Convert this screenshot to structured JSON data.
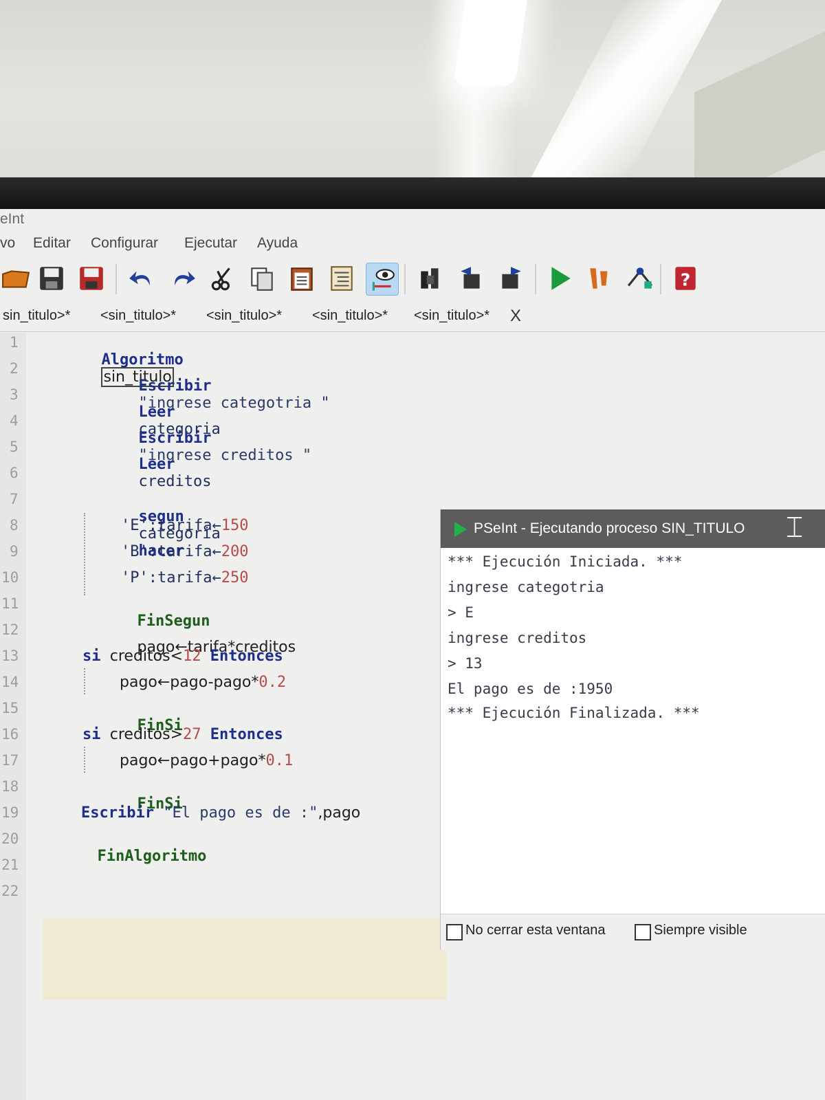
{
  "window": {
    "title": "eInt"
  },
  "menu": {
    "items": [
      "vo",
      "Editar",
      "Configurar",
      "Ejecutar",
      "Ayuda"
    ]
  },
  "toolbar": {
    "icons": [
      "open-folder-icon",
      "save-icon",
      "save-as-icon",
      "undo-icon",
      "redo-icon",
      "cut-icon",
      "copy-icon",
      "paste-icon",
      "indent-icon",
      "debug-watch-icon",
      "search-icon",
      "search-prev-icon",
      "search-next-icon",
      "run-icon",
      "step-icon",
      "flowchart-icon",
      "help-icon"
    ]
  },
  "tabs": {
    "items": [
      "sin_titulo>*",
      "<sin_titulo>*",
      "<sin_titulo>*",
      "<sin_titulo>*",
      "<sin_titulo>*"
    ],
    "close": "X"
  },
  "editor": {
    "line_numbers": [
      "1",
      "2",
      "3",
      "4",
      "5",
      "6",
      "7",
      "8",
      "9",
      "10",
      "11",
      "12",
      "13",
      "14",
      "15",
      "16",
      "17",
      "18",
      "19",
      "20",
      "21",
      "22"
    ],
    "lines": {
      "l1_kw": "Algoritmo",
      "l1_name": "sin_titulo",
      "l2_kw": "Escribir",
      "l2_str": "\"ingrese categotria \"",
      "l3_kw": "Leer",
      "l3_id": "categoria",
      "l4_kw": "Escribir",
      "l4_str": "\"ingrese creditos \"",
      "l5_kw": "Leer",
      "l5_id": "creditos",
      "l7_kw": "segun",
      "l7_id": "categoria",
      "l7_kw2": "hacer",
      "l8_a": "'E'",
      "l8_b": ":tarifa←",
      "l8_n": "150",
      "l9_a": "'B'",
      "l9_b": ":tarifa←",
      "l9_n": "200",
      "l10_a": "'P'",
      "l10_b": ":tarifa←",
      "l10_n": "250",
      "l11_kw": "FinSegun",
      "l12_id": "pago←tarifa*creditos",
      "l13_kw": "si",
      "l13_id": "creditos<",
      "l13_n": "12",
      "l13_kw2": "Entonces",
      "l14_id": "pago←pago-pago*",
      "l14_n": "0.2",
      "l15_kw": "FinSi",
      "l16_kw": "si",
      "l16_id": "creditos>",
      "l16_n": "27",
      "l16_kw2": "Entonces",
      "l17_id": "pago←pago+pago*",
      "l17_n": "0.1",
      "l18_kw": "FinSi",
      "l19_kw": "Escribir",
      "l19_str": "\"El pago es de :\"",
      "l19_id": ",pago",
      "l20_kw": "FinAlgoritmo"
    }
  },
  "run_window": {
    "title": "PSeInt - Ejecutando proceso SIN_TITULO",
    "output": [
      "*** Ejecución Iniciada. ***",
      "ingrese categotria",
      "> E",
      "ingrese creditos",
      "> 13",
      "El pago es de :1950",
      "*** Ejecución Finalizada. ***"
    ],
    "no_cerrar_label": "No cerrar esta ventana",
    "siempre_visible_label": "Siempre visible"
  },
  "colors": {
    "keyword": "#1d2e8c",
    "number": "#b84a4a",
    "highlight": "#f0ead2",
    "run_title_bg": "#5c5c5c",
    "run_icon": "#22b14c"
  }
}
